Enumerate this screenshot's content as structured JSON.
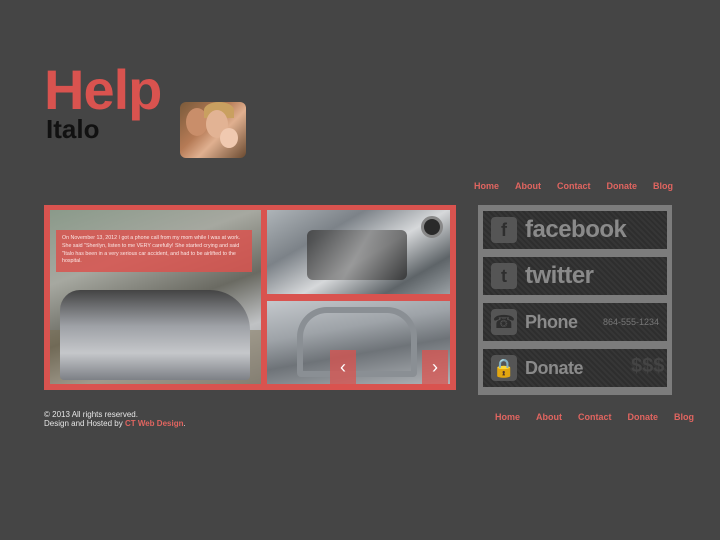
{
  "logo": {
    "line1": "Help",
    "line2": "Italo"
  },
  "nav": {
    "items": [
      "Home",
      "About",
      "Contact",
      "Donate",
      "Blog"
    ]
  },
  "gallery": {
    "caption": "On November 13, 2012 I got a phone call from my mom while I was at work. She said \"Sherilyn, listen to me VERY carefully! She started crying and said \"Italo has been in a very serious car accident, and had to be airlifted to the hospital.",
    "prev_icon": "chevron-left-icon",
    "next_icon": "chevron-right-icon"
  },
  "social": {
    "facebook": {
      "label": "facebook",
      "icon": "facebook-icon"
    },
    "twitter": {
      "label": "twitter",
      "icon": "twitter-icon"
    },
    "phone": {
      "label": "Phone",
      "number": "864-555-1234",
      "icon": "phone-icon"
    },
    "donate": {
      "label": "Donate",
      "extra": "$$$",
      "icon": "lock-icon"
    }
  },
  "footer": {
    "copyright": "© 2013 All rights reserved.",
    "designed_prefix": "Design and Hosted by ",
    "designer": "CT Web Design",
    "designed_suffix": "."
  },
  "colors": {
    "accent": "#d9534f",
    "background": "#454545"
  }
}
